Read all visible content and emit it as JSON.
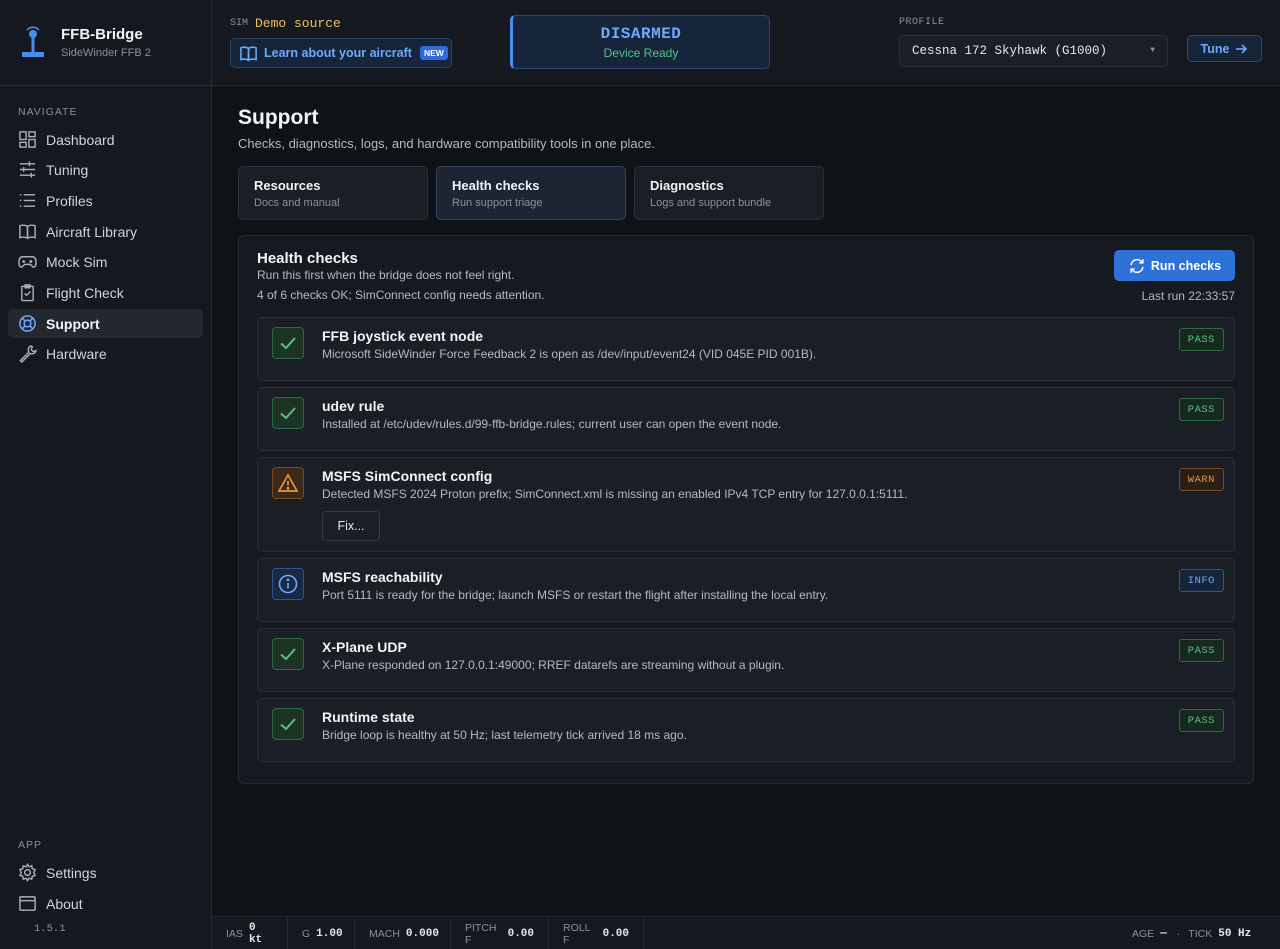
{
  "brand": {
    "title": "FFB-Bridge",
    "subtitle": "SideWinder FFB 2"
  },
  "topbar": {
    "sim_label": "SIM",
    "sim_value": "Demo source",
    "learn_label": "Learn about your aircraft",
    "new_badge": "NEW",
    "arm_state": "DISARMED",
    "arm_sub": "Device Ready",
    "profile_label": "PROFILE",
    "profile_value": "Cessna 172 Skyhawk (G1000)",
    "tune_label": "Tune"
  },
  "sidebar": {
    "nav_heading": "NAVIGATE",
    "items": [
      {
        "label": "Dashboard",
        "icon": "dashboard-icon"
      },
      {
        "label": "Tuning",
        "icon": "sliders-icon"
      },
      {
        "label": "Profiles",
        "icon": "list-icon"
      },
      {
        "label": "Aircraft Library",
        "icon": "book-icon"
      },
      {
        "label": "Mock Sim",
        "icon": "gamepad-icon"
      },
      {
        "label": "Flight Check",
        "icon": "clipboard-icon"
      },
      {
        "label": "Support",
        "icon": "lifebuoy-icon",
        "active": true
      },
      {
        "label": "Hardware",
        "icon": "wrench-icon"
      }
    ],
    "app_heading": "APP",
    "app_items": [
      {
        "label": "Settings",
        "icon": "gear-icon"
      },
      {
        "label": "About",
        "icon": "window-icon"
      }
    ],
    "version": "1.5.1"
  },
  "page": {
    "title": "Support",
    "subtitle": "Checks, diagnostics, logs, and hardware compatibility tools in one place.",
    "tabs": [
      {
        "title": "Resources",
        "sub": "Docs and manual"
      },
      {
        "title": "Health checks",
        "sub": "Run support triage",
        "active": true
      },
      {
        "title": "Diagnostics",
        "sub": "Logs and support bundle"
      }
    ]
  },
  "health": {
    "title": "Health checks",
    "subtitle": "Run this first when the bridge does not feel right.",
    "status": "4 of 6 checks OK; SimConnect config needs attention.",
    "run_label": "Run checks",
    "last_run": "Last run 22:33:57",
    "checks": [
      {
        "title": "FFB joystick event node",
        "desc": "Microsoft SideWinder Force Feedback 2 is open as /dev/input/event24 (VID 045E PID 001B).",
        "status": "PASS"
      },
      {
        "title": "udev rule",
        "desc": "Installed at /etc/udev/rules.d/99-ffb-bridge.rules; current user can open the event node.",
        "status": "PASS"
      },
      {
        "title": "MSFS SimConnect config",
        "desc": "Detected MSFS 2024 Proton prefix; SimConnect.xml is missing an enabled IPv4 TCP entry for 127.0.0.1:5111.",
        "status": "WARN",
        "action": "Fix..."
      },
      {
        "title": "MSFS reachability",
        "desc": "Port 5111 is ready for the bridge; launch MSFS or restart the flight after installing the local entry.",
        "status": "INFO"
      },
      {
        "title": "X-Plane UDP",
        "desc": "X-Plane responded on 127.0.0.1:49000; RREF datarefs are streaming without a plugin.",
        "status": "PASS"
      },
      {
        "title": "Runtime state",
        "desc": "Bridge loop is healthy at 50 Hz; last telemetry tick arrived 18 ms ago.",
        "status": "PASS"
      }
    ]
  },
  "statusbar": {
    "ias_label": "IAS",
    "ias": "0 kt",
    "g_label": "G",
    "g": "1.00",
    "mach_label": "MACH",
    "mach": "0.000",
    "pitch_label": "PITCH F",
    "pitch": "0.00",
    "roll_label": "ROLL F",
    "roll": "0.00",
    "age_label": "AGE",
    "age": "—",
    "sep": "·",
    "tick_label": "TICK",
    "tick": "50 Hz"
  },
  "colors": {
    "accent": "#2e72d9",
    "pass": "#57c481",
    "warn": "#f0923c",
    "info": "#6fa8ff",
    "sim": "#f0c05a"
  }
}
